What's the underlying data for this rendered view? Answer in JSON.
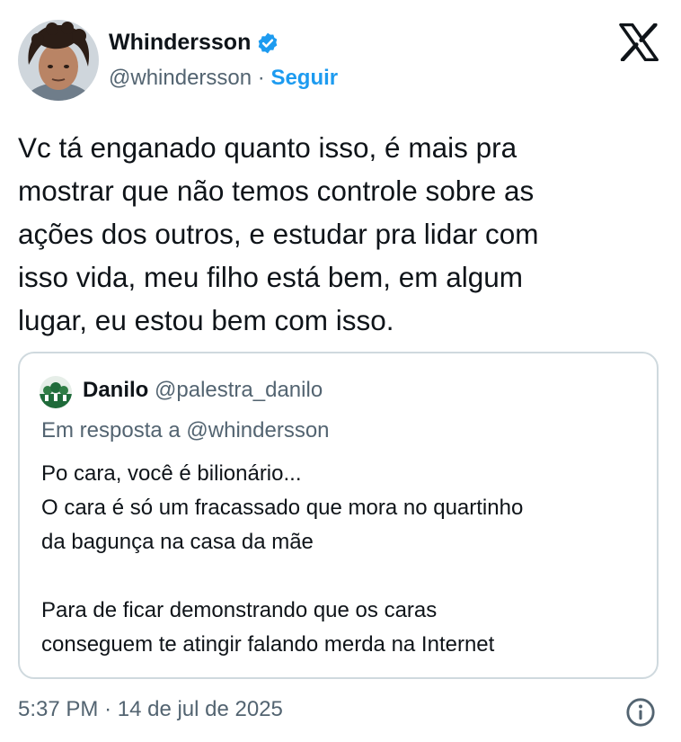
{
  "author": {
    "name": "Whindersson",
    "handle": "@whindersson",
    "separator": "·",
    "follow_label": "Seguir",
    "verified_icon": "verified-badge-icon",
    "verified_color": "#1d9bf0"
  },
  "brand": {
    "icon": "x-logo-icon"
  },
  "tweet": {
    "lines": [
      "Vc tá enganado quanto isso, é mais pra",
      "mostrar que não temos controle sobre as",
      "ações dos outros, e estudar pra lidar com",
      "isso vida, meu filho está bem, em algum",
      "lugar, eu estou bem com isso."
    ]
  },
  "quoted": {
    "name": "Danilo",
    "handle": "@palestra_danilo",
    "reply_to": "Em resposta a @whindersson",
    "paragraphs": [
      "Po cara, você é bilionário...",
      "O cara é só um fracassado que mora no quartinho",
      "da bagunça na casa da mãe",
      "",
      "Para de ficar demonstrando que os caras",
      "conseguem te atingir falando merda na Internet"
    ]
  },
  "footer": {
    "time": "5:37 PM",
    "separator": "·",
    "date": "14 de jul de 2025",
    "info_icon": "info-icon"
  },
  "colors": {
    "text": "#0f1419",
    "secondary": "#536471",
    "accent": "#1d9bf0",
    "border": "#cfd9de"
  }
}
